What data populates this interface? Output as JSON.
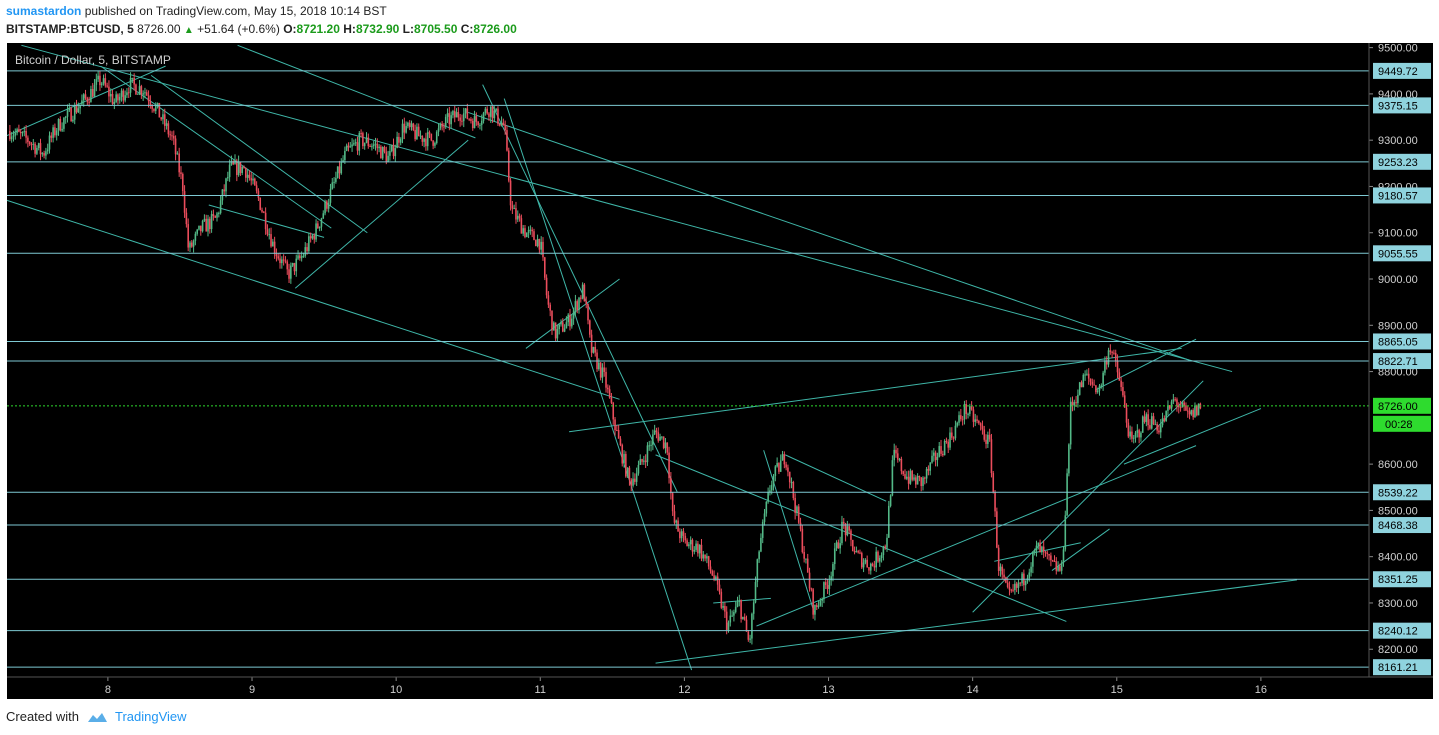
{
  "header": {
    "user": "sumastardon",
    "published": "published on TradingView.com, May 15, 2018 10:14 BST",
    "symbol": "BITSTAMP:BTCUSD, 5",
    "price": "8726.00",
    "change": "+51.64 (+0.6%)",
    "o_label": "O:",
    "o": "8721.20",
    "h_label": "H:",
    "h": "8732.90",
    "l_label": "L:",
    "l": "8705.50",
    "c_label": "C:",
    "c": "8726.00"
  },
  "footer": {
    "created_with": "Created with",
    "brand": "TradingView"
  },
  "colors": {
    "background": "#000000",
    "up": "#53b987",
    "down": "#eb4d5c",
    "trend_line": "#3fb6a8",
    "level_line": "#7ec9d3",
    "level_label_bg": "#8fd3de",
    "current_price_bg": "#2edb2e"
  },
  "chart_data": {
    "type": "candlestick",
    "title": "Bitcoin / Dollar, 5, BITSTAMP",
    "x_ticks": [
      "8",
      "9",
      "10",
      "11",
      "12",
      "13",
      "14",
      "15",
      "16"
    ],
    "y_ticks": [
      "9500.00",
      "9400.00",
      "9300.00",
      "9200.00",
      "9100.00",
      "9000.00",
      "8900.00",
      "8800.00",
      "8600.00",
      "8500.00",
      "8400.00",
      "8300.00",
      "8200.00"
    ],
    "ylim": [
      8140,
      9510
    ],
    "xlim": [
      7.3,
      16.75
    ],
    "horizontal_levels": [
      "9449.72",
      "9375.15",
      "9253.23",
      "9180.57",
      "9055.55",
      "8865.05",
      "8822.71",
      "8726.00",
      "8539.22",
      "8468.38",
      "8351.25",
      "8240.12",
      "8161.21"
    ],
    "current_price": "8726.00",
    "countdown": "00:28",
    "price_path": [
      [
        7.32,
        9320
      ],
      [
        7.45,
        9300
      ],
      [
        7.55,
        9270
      ],
      [
        7.65,
        9330
      ],
      [
        7.75,
        9360
      ],
      [
        7.85,
        9390
      ],
      [
        7.95,
        9430
      ],
      [
        8.05,
        9380
      ],
      [
        8.15,
        9420
      ],
      [
        8.25,
        9410
      ],
      [
        8.35,
        9360
      ],
      [
        8.45,
        9300
      ],
      [
        8.52,
        9200
      ],
      [
        8.56,
        9060
      ],
      [
        8.65,
        9110
      ],
      [
        8.75,
        9130
      ],
      [
        8.85,
        9240
      ],
      [
        8.95,
        9240
      ],
      [
        9.05,
        9170
      ],
      [
        9.15,
        9070
      ],
      [
        9.25,
        9010
      ],
      [
        9.35,
        9050
      ],
      [
        9.45,
        9110
      ],
      [
        9.55,
        9190
      ],
      [
        9.65,
        9270
      ],
      [
        9.75,
        9300
      ],
      [
        9.85,
        9290
      ],
      [
        9.95,
        9260
      ],
      [
        10.05,
        9330
      ],
      [
        10.15,
        9310
      ],
      [
        10.25,
        9300
      ],
      [
        10.35,
        9340
      ],
      [
        10.45,
        9360
      ],
      [
        10.55,
        9340
      ],
      [
        10.65,
        9370
      ],
      [
        10.75,
        9330
      ],
      [
        10.8,
        9150
      ],
      [
        10.9,
        9100
      ],
      [
        11.0,
        9080
      ],
      [
        11.05,
        8950
      ],
      [
        11.1,
        8880
      ],
      [
        11.2,
        8910
      ],
      [
        11.3,
        8980
      ],
      [
        11.35,
        8850
      ],
      [
        11.45,
        8780
      ],
      [
        11.55,
        8640
      ],
      [
        11.62,
        8560
      ],
      [
        11.7,
        8600
      ],
      [
        11.8,
        8670
      ],
      [
        11.88,
        8640
      ],
      [
        11.92,
        8480
      ],
      [
        12.0,
        8430
      ],
      [
        12.1,
        8420
      ],
      [
        12.2,
        8360
      ],
      [
        12.3,
        8250
      ],
      [
        12.38,
        8300
      ],
      [
        12.45,
        8210
      ],
      [
        12.52,
        8420
      ],
      [
        12.6,
        8560
      ],
      [
        12.7,
        8620
      ],
      [
        12.8,
        8460
      ],
      [
        12.9,
        8280
      ],
      [
        13.0,
        8350
      ],
      [
        13.1,
        8470
      ],
      [
        13.2,
        8400
      ],
      [
        13.3,
        8380
      ],
      [
        13.4,
        8430
      ],
      [
        13.45,
        8620
      ],
      [
        13.55,
        8570
      ],
      [
        13.65,
        8560
      ],
      [
        13.75,
        8620
      ],
      [
        13.85,
        8660
      ],
      [
        13.95,
        8720
      ],
      [
        14.05,
        8680
      ],
      [
        14.12,
        8640
      ],
      [
        14.18,
        8380
      ],
      [
        14.25,
        8310
      ],
      [
        14.35,
        8350
      ],
      [
        14.45,
        8420
      ],
      [
        14.55,
        8380
      ],
      [
        14.62,
        8370
      ],
      [
        14.68,
        8720
      ],
      [
        14.78,
        8790
      ],
      [
        14.88,
        8760
      ],
      [
        14.95,
        8860
      ],
      [
        15.02,
        8780
      ],
      [
        15.1,
        8640
      ],
      [
        15.2,
        8700
      ],
      [
        15.3,
        8680
      ],
      [
        15.4,
        8740
      ],
      [
        15.5,
        8700
      ],
      [
        15.58,
        8726
      ]
    ],
    "trend_lines": [
      [
        [
          7.3,
          9170
        ],
        [
          11.55,
          8740
        ]
      ],
      [
        [
          7.4,
          9505
        ],
        [
          15.8,
          8800
        ]
      ],
      [
        [
          8.9,
          9505
        ],
        [
          10.55,
          9305
        ]
      ],
      [
        [
          10.5,
          9360
        ],
        [
          15.5,
          8825
        ]
      ],
      [
        [
          10.6,
          9420
        ],
        [
          11.95,
          8540
        ]
      ],
      [
        [
          10.75,
          9390
        ],
        [
          12.05,
          8155
        ]
      ],
      [
        [
          11.2,
          8670
        ],
        [
          15.45,
          8850
        ]
      ],
      [
        [
          11.8,
          8620
        ],
        [
          14.65,
          8260
        ]
      ],
      [
        [
          11.8,
          8170
        ],
        [
          16.25,
          8350
        ]
      ],
      [
        [
          12.5,
          8250
        ],
        [
          15.55,
          8640
        ]
      ],
      [
        [
          14.0,
          8280
        ],
        [
          15.6,
          8780
        ]
      ],
      [
        [
          12.7,
          8620
        ],
        [
          13.4,
          8520
        ]
      ],
      [
        [
          14.85,
          8760
        ],
        [
          15.55,
          8870
        ]
      ],
      [
        [
          12.2,
          8300
        ],
        [
          12.6,
          8310
        ]
      ],
      [
        [
          7.3,
          9310
        ],
        [
          8.4,
          9460
        ]
      ],
      [
        [
          8.3,
          9440
        ],
        [
          9.8,
          9100
        ]
      ],
      [
        [
          7.95,
          9460
        ],
        [
          9.55,
          9110
        ]
      ],
      [
        [
          8.7,
          9160
        ],
        [
          9.5,
          9090
        ]
      ],
      [
        [
          9.3,
          8980
        ],
        [
          10.5,
          9300
        ]
      ],
      [
        [
          10.9,
          8850
        ],
        [
          11.55,
          9000
        ]
      ],
      [
        [
          12.55,
          8630
        ],
        [
          12.9,
          8280
        ]
      ],
      [
        [
          14.15,
          8390
        ],
        [
          14.75,
          8430
        ]
      ],
      [
        [
          14.55,
          8370
        ],
        [
          14.95,
          8460
        ]
      ],
      [
        [
          15.05,
          8600
        ],
        [
          16.0,
          8720
        ]
      ]
    ]
  }
}
